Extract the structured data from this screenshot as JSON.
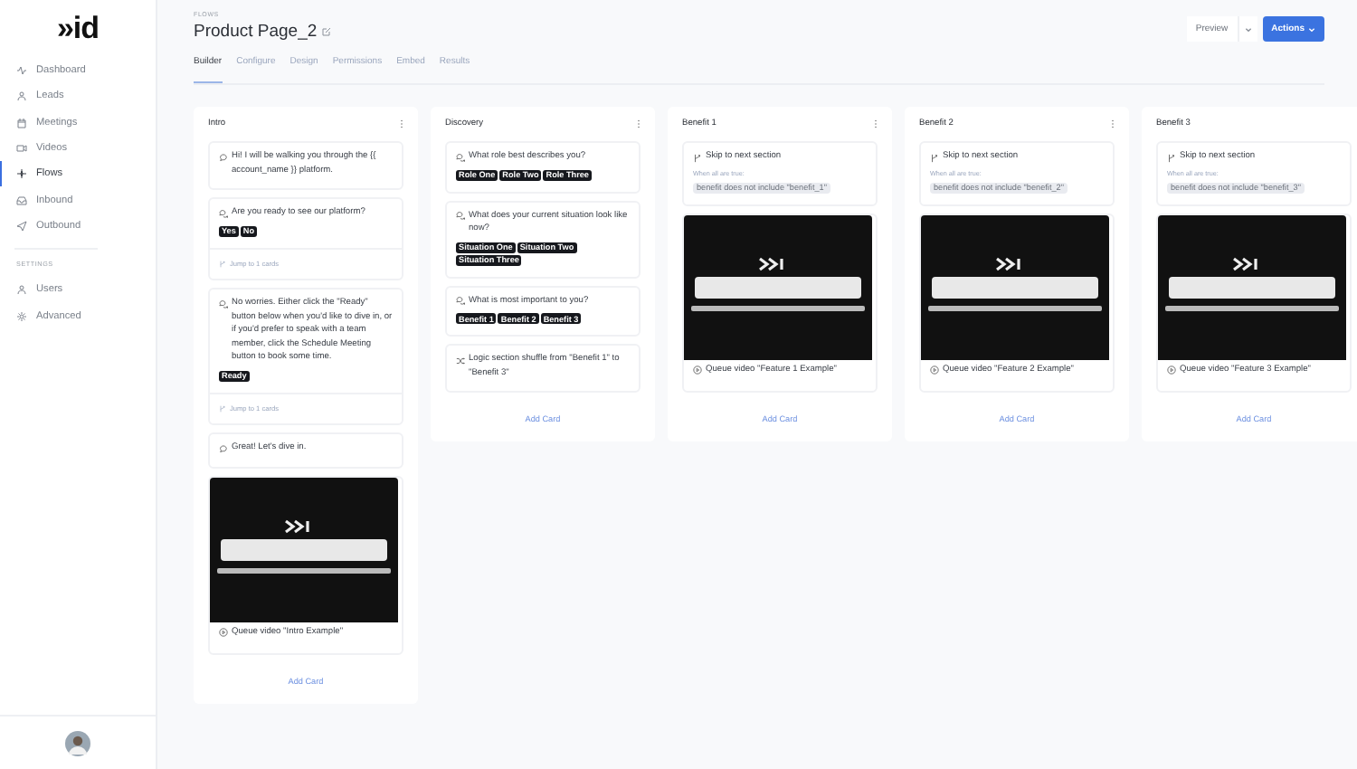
{
  "sidebar": {
    "logo": "»id",
    "nav": [
      {
        "label": "Dashboard",
        "selected": false
      },
      {
        "label": "Leads",
        "selected": false
      },
      {
        "label": "Meetings",
        "selected": false
      },
      {
        "label": "Videos",
        "selected": false
      },
      {
        "label": "Flows",
        "selected": true
      },
      {
        "label": "Inbound",
        "selected": false
      },
      {
        "label": "Outbound",
        "selected": false
      }
    ],
    "settings_heading": "SETTINGS",
    "settings": [
      {
        "label": "Users",
        "selected": false
      },
      {
        "label": "Advanced",
        "selected": false
      }
    ]
  },
  "header": {
    "breadcrumb": "FLOWS",
    "title": "Product Page_2",
    "preview": "Preview",
    "actions": "Actions"
  },
  "tabs": [
    {
      "label": "Builder",
      "selected": true
    },
    {
      "label": "Configure",
      "selected": false
    },
    {
      "label": "Design",
      "selected": false
    },
    {
      "label": "Permissions",
      "selected": false
    },
    {
      "label": "Embed",
      "selected": false
    },
    {
      "label": "Results",
      "selected": false
    }
  ],
  "columns": [
    {
      "title": "Intro",
      "menu": true,
      "add_card": "Add Card",
      "cards": [
        {
          "kind": "message",
          "text": "Hi! I will be walking you through the {{ account_name }} platform."
        },
        {
          "kind": "question",
          "text": "Are you ready to see our platform?",
          "chips": [
            "Yes",
            "No"
          ],
          "jump": "Jump to 1 cards"
        },
        {
          "kind": "question",
          "text": "No worries. Either click the \"Ready\" button below when you'd like to dive in, or if you'd prefer to speak with a team member, click the Schedule Meeting button to book some time.",
          "chips": [
            "Ready"
          ],
          "jump": "Jump to 1 cards"
        },
        {
          "kind": "message",
          "text": "Great! Let's dive in."
        },
        {
          "kind": "video",
          "text": "Queue video \"Intro Example\""
        }
      ]
    },
    {
      "title": "Discovery",
      "menu": true,
      "add_card": "Add Card",
      "cards": [
        {
          "kind": "question",
          "text": "What role best describes you?",
          "chips": [
            "Role One",
            "Role Two",
            "Role Three"
          ]
        },
        {
          "kind": "question",
          "text": "What does your current situation look like now?",
          "chips": [
            "Situation One",
            "Situation Two",
            "Situation Three"
          ]
        },
        {
          "kind": "question",
          "text": "What is most important to you?",
          "chips": [
            "Benefit 1",
            "Benefit 2",
            "Benefit 3"
          ]
        },
        {
          "kind": "logic",
          "text": "Logic section shuffle from \"Benefit 1\" to \"Benefit 3\""
        }
      ]
    },
    {
      "title": "Benefit 1",
      "menu": true,
      "add_card": "Add Card",
      "cards": [
        {
          "kind": "skip",
          "text": "Skip to next section",
          "condition": "When all are true:",
          "tag": "benefit does not include \"benefit_1\""
        },
        {
          "kind": "video",
          "text": "Queue video \"Feature 1 Example\""
        }
      ]
    },
    {
      "title": "Benefit 2",
      "menu": true,
      "add_card": "Add Card",
      "cards": [
        {
          "kind": "skip",
          "text": "Skip to next section",
          "condition": "When all are true:",
          "tag": "benefit does not include \"benefit_2\""
        },
        {
          "kind": "video",
          "text": "Queue video \"Feature 2 Example\""
        }
      ]
    },
    {
      "title": "Benefit 3",
      "menu": false,
      "add_card": "Add Card",
      "cards": [
        {
          "kind": "skip",
          "text": "Skip to next section",
          "condition": "When all are true:",
          "tag": "benefit does not include \"benefit_3\""
        },
        {
          "kind": "video",
          "text": "Queue video \"Feature 3 Example\""
        }
      ]
    }
  ]
}
